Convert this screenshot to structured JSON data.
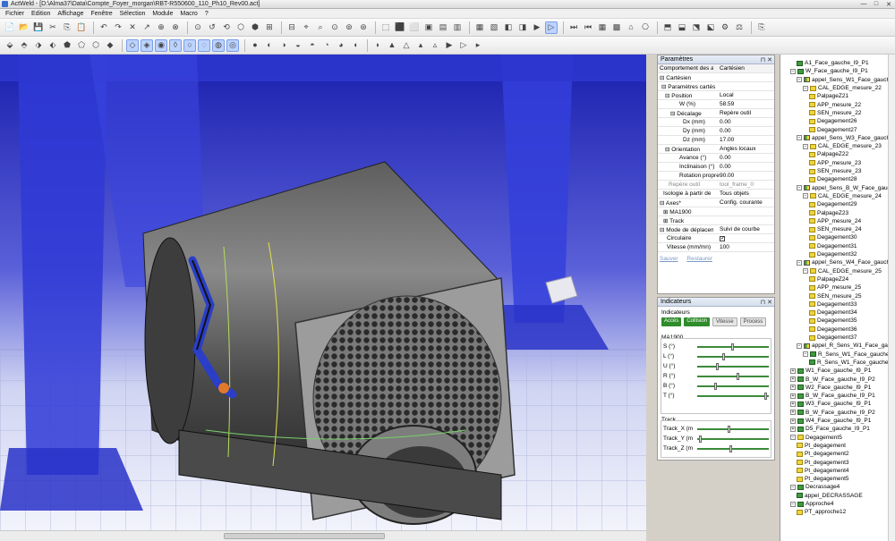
{
  "window": {
    "title": "ActWeld - [D:\\Alma37\\Data\\Compte_Foyer_morgan\\RBT-R550600_110_Ph10_Rev00.act]",
    "controls": [
      "—",
      "□",
      "✕"
    ]
  },
  "menu": [
    "Fichier",
    "Edition",
    "Affichage",
    "Fenêtre",
    "Sélection",
    "Module",
    "Macro",
    "?"
  ],
  "toolbar1": [
    "📄",
    "📂",
    "💾",
    "✂",
    "⎘",
    "📋",
    "↶",
    "↷",
    "✕",
    "↗",
    "⊕",
    "⊗",
    "⊙",
    "↺",
    "⟲",
    "⬡",
    "⬢",
    "⊞",
    "⊟",
    "⌖",
    "⌕",
    "⊙",
    "⊚",
    "⊛",
    "⬚",
    "⬛",
    "⬜",
    "▣",
    "▤",
    "▥",
    "▦",
    "▧",
    "◧",
    "◨",
    "▶",
    "▷",
    "⏭",
    "⏮",
    "▦",
    "▩",
    "⌂",
    "⎔",
    "⬒",
    "⬓",
    "⬔",
    "⬕",
    "⚙",
    "⚖",
    "⎘"
  ],
  "toolbar2": [
    "⬙",
    "⬘",
    "⬗",
    "⬖",
    "⬟",
    "⬠",
    "⬡",
    "◆",
    "◇",
    "◈",
    "◉",
    "◊",
    "○",
    "◌",
    "◍",
    "◎",
    "●",
    "◐",
    "◑",
    "◒",
    "◓",
    "◔",
    "◕",
    "◖",
    "◗",
    "▲",
    "△",
    "▴",
    "▵",
    "▶",
    "▷",
    "▸"
  ],
  "params": {
    "title": "Paramètres",
    "rows": [
      {
        "label": "Comportement des axes",
        "value": "Cartésien",
        "indent": 0,
        "style": "grey"
      },
      {
        "label": "⊟ Cartésien",
        "value": "",
        "indent": 0,
        "style": ""
      },
      {
        "label": "⊟ Paramètres cartésiens",
        "value": "",
        "indent": 2,
        "style": ""
      },
      {
        "label": "⊟ Position",
        "value": "Local",
        "indent": 6,
        "style": ""
      },
      {
        "label": "W (%)",
        "value": "58.59",
        "indent": 22,
        "style": ""
      },
      {
        "label": "⊟ Décalage",
        "value": "Repère outil",
        "indent": 12,
        "style": ""
      },
      {
        "label": "Dx (mm)",
        "value": "0.00",
        "indent": 26,
        "style": ""
      },
      {
        "label": "Dy (mm)",
        "value": "0.00",
        "indent": 26,
        "style": ""
      },
      {
        "label": "Dz (mm)",
        "value": "17.00",
        "indent": 26,
        "style": ""
      },
      {
        "label": "⊟ Orientation",
        "value": "Angles locaux",
        "indent": 6,
        "style": ""
      },
      {
        "label": "Avance (°)",
        "value": "0.00",
        "indent": 22,
        "style": ""
      },
      {
        "label": "Inclinaison (°)",
        "value": "0.00",
        "indent": 22,
        "style": ""
      },
      {
        "label": "Rotation propre",
        "value": "90.00",
        "indent": 22,
        "style": ""
      },
      {
        "label": "Repère outil",
        "value": "tool_frame_0",
        "indent": 10,
        "style": "dim"
      },
      {
        "label": "Isologie à partir de",
        "value": "Tous objets",
        "indent": 4,
        "style": ""
      },
      {
        "label": "⊟ Axes*",
        "value": "Config. courante",
        "indent": 0,
        "style": ""
      },
      {
        "label": "⊞ MA1900",
        "value": "",
        "indent": 4,
        "style": ""
      },
      {
        "label": "⊞ Track",
        "value": "",
        "indent": 4,
        "style": ""
      },
      {
        "label": "⊟ Mode de déplacement",
        "value": "Suivi de courbe",
        "indent": 0,
        "style": ""
      },
      {
        "label": "Circulaire",
        "value": "✓",
        "indent": 8,
        "style": "check"
      },
      {
        "label": "Vitesse (mm/mn)",
        "value": "100",
        "indent": 8,
        "style": ""
      }
    ],
    "links": [
      "Sauver",
      "Restaurer"
    ]
  },
  "indicators": {
    "title": "Indicateurs",
    "group_label": "Indicateurs",
    "buttons": [
      {
        "label": "Accès",
        "state": "g"
      },
      {
        "label": "Collision",
        "state": "g"
      },
      {
        "label": "Vitesse",
        "state": "w"
      },
      {
        "label": "Process",
        "state": "w"
      }
    ],
    "ma_label": "MA1900",
    "ma_axes": [
      {
        "name": "S (°)",
        "value": 0.48
      },
      {
        "name": "L (°)",
        "value": 0.35
      },
      {
        "name": "U (°)",
        "value": 0.26
      },
      {
        "name": "R (°)",
        "value": 0.55
      },
      {
        "name": "B (°)",
        "value": 0.24
      },
      {
        "name": "T (°)",
        "value": 0.94
      }
    ],
    "track_label": "Track",
    "track_axes": [
      {
        "name": "Track_X (m",
        "value": 0.42
      },
      {
        "name": "Track_Y (m",
        "value": 0.02
      },
      {
        "name": "Track_Z (m",
        "value": 0.45
      }
    ]
  },
  "tree": [
    {
      "label": "A1_Face_gauche_I9_P1",
      "level": 2,
      "exp": "",
      "icon": "gr"
    },
    {
      "label": "W_Face_gauche_I9_P1",
      "level": 1,
      "exp": "⊟",
      "icon": "gr"
    },
    {
      "label": "appel_Sens_W1_Face_gauche",
      "level": 2,
      "exp": "⊟",
      "icon": "mix"
    },
    {
      "label": "CAL_EDGE_mesure_22",
      "level": 3,
      "exp": "⊟",
      "icon": "y"
    },
    {
      "label": "PalpageZ21",
      "level": 4,
      "exp": "",
      "icon": "y"
    },
    {
      "label": "APP_mesure_22",
      "level": 4,
      "exp": "",
      "icon": "y"
    },
    {
      "label": "SEN_mesure_22",
      "level": 4,
      "exp": "",
      "icon": "y"
    },
    {
      "label": "Degagement26",
      "level": 4,
      "exp": "",
      "icon": "y"
    },
    {
      "label": "Degagement27",
      "level": 4,
      "exp": "",
      "icon": "y"
    },
    {
      "label": "appel_Sens_W3_Face_gauche",
      "level": 2,
      "exp": "⊟",
      "icon": "mix"
    },
    {
      "label": "CAL_EDGE_mesure_23",
      "level": 3,
      "exp": "⊟",
      "icon": "y"
    },
    {
      "label": "PalpageZ22",
      "level": 4,
      "exp": "",
      "icon": "y"
    },
    {
      "label": "APP_mesure_23",
      "level": 4,
      "exp": "",
      "icon": "y"
    },
    {
      "label": "SEN_mesure_23",
      "level": 4,
      "exp": "",
      "icon": "y"
    },
    {
      "label": "Degagement28",
      "level": 4,
      "exp": "",
      "icon": "y"
    },
    {
      "label": "appel_Sens_B_W_Face_gauche",
      "level": 2,
      "exp": "⊟",
      "icon": "mix"
    },
    {
      "label": "CAL_EDGE_mesure_24",
      "level": 3,
      "exp": "⊟",
      "icon": "y"
    },
    {
      "label": "Degagement29",
      "level": 4,
      "exp": "",
      "icon": "y"
    },
    {
      "label": "PalpageZ23",
      "level": 4,
      "exp": "",
      "icon": "y"
    },
    {
      "label": "APP_mesure_24",
      "level": 4,
      "exp": "",
      "icon": "y"
    },
    {
      "label": "SEN_mesure_24",
      "level": 4,
      "exp": "",
      "icon": "y"
    },
    {
      "label": "Degagement30",
      "level": 4,
      "exp": "",
      "icon": "y"
    },
    {
      "label": "Degagement31",
      "level": 4,
      "exp": "",
      "icon": "y"
    },
    {
      "label": "Degagement32",
      "level": 4,
      "exp": "",
      "icon": "y"
    },
    {
      "label": "appel_Sens_W4_Face_gauche",
      "level": 2,
      "exp": "⊟",
      "icon": "mix"
    },
    {
      "label": "CAL_EDGE_mesure_25",
      "level": 3,
      "exp": "⊟",
      "icon": "y"
    },
    {
      "label": "PalpageZ24",
      "level": 4,
      "exp": "",
      "icon": "y"
    },
    {
      "label": "APP_mesure_25",
      "level": 4,
      "exp": "",
      "icon": "y"
    },
    {
      "label": "SEN_mesure_25",
      "level": 4,
      "exp": "",
      "icon": "y"
    },
    {
      "label": "Degagement33",
      "level": 4,
      "exp": "",
      "icon": "y"
    },
    {
      "label": "Degagement34",
      "level": 4,
      "exp": "",
      "icon": "y"
    },
    {
      "label": "Degagement35",
      "level": 4,
      "exp": "",
      "icon": "y"
    },
    {
      "label": "Degagement36",
      "level": 4,
      "exp": "",
      "icon": "y"
    },
    {
      "label": "Degagement37",
      "level": 4,
      "exp": "",
      "icon": "y"
    },
    {
      "label": "appel_R_Sens_W1_Face_gauche",
      "level": 2,
      "exp": "⊟",
      "icon": "mix"
    },
    {
      "label": "R_Sens_W1_Face_gauche",
      "level": 3,
      "exp": "⊟",
      "icon": "gr"
    },
    {
      "label": "R_Sens_W1_Face_gauche",
      "level": 4,
      "exp": "",
      "icon": "gr"
    },
    {
      "label": "W1_Face_gauche_I9_P1",
      "level": 1,
      "exp": "⊞",
      "icon": "gr"
    },
    {
      "label": "B_W_Face_gauche_I9_P2",
      "level": 1,
      "exp": "⊞",
      "icon": "gr"
    },
    {
      "label": "W2_Face_gauche_I9_P1",
      "level": 1,
      "exp": "⊞",
      "icon": "gr"
    },
    {
      "label": "B_W_Face_gauche_I9_P1",
      "level": 1,
      "exp": "⊞",
      "icon": "gr"
    },
    {
      "label": "W3_Face_gauche_I9_P1",
      "level": 1,
      "exp": "⊞",
      "icon": "gr"
    },
    {
      "label": "B_W_Face_gauche_I9_P2",
      "level": 1,
      "exp": "⊞",
      "icon": "gr"
    },
    {
      "label": "W4_Face_gauche_I9_P1",
      "level": 1,
      "exp": "⊞",
      "icon": "gr"
    },
    {
      "label": "D5_Face_gauche_I9_P1",
      "level": 1,
      "exp": "⊞",
      "icon": "gr"
    },
    {
      "label": "Degagement5",
      "level": 1,
      "exp": "⊟",
      "icon": "y"
    },
    {
      "label": "Pt_degagement",
      "level": 2,
      "exp": "",
      "icon": "y"
    },
    {
      "label": "Pt_degagement2",
      "level": 2,
      "exp": "",
      "icon": "y"
    },
    {
      "label": "Pt_degagement3",
      "level": 2,
      "exp": "",
      "icon": "y"
    },
    {
      "label": "Pt_degagement4",
      "level": 2,
      "exp": "",
      "icon": "y"
    },
    {
      "label": "Pt_degagement5",
      "level": 2,
      "exp": "",
      "icon": "y"
    },
    {
      "label": "Decrassage4",
      "level": 1,
      "exp": "⊟",
      "icon": "gr"
    },
    {
      "label": "appel_DECRASSAGE",
      "level": 2,
      "exp": "",
      "icon": "gr"
    },
    {
      "label": "Approche4",
      "level": 1,
      "exp": "⊟",
      "icon": "gr"
    },
    {
      "label": "PT_approche12",
      "level": 2,
      "exp": "",
      "icon": "y"
    }
  ]
}
